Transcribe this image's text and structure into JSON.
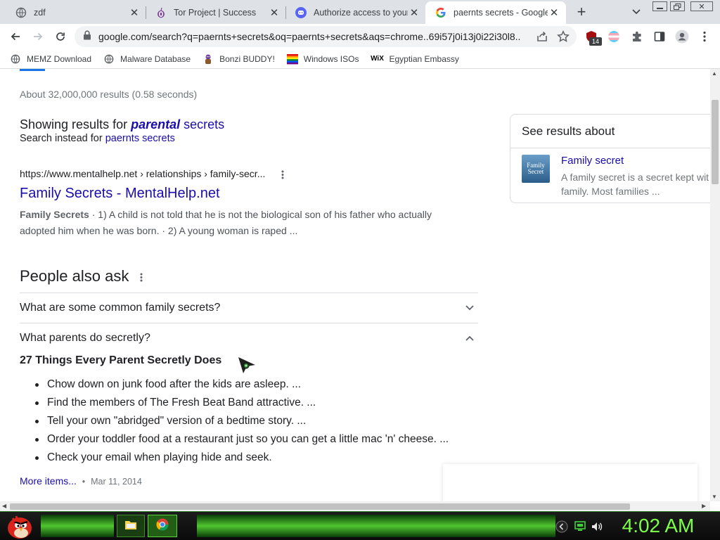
{
  "tabs": [
    {
      "title": "zdf",
      "icon": "globe-icon"
    },
    {
      "title": "Tor Project | Success",
      "icon": "tor-onion-icon"
    },
    {
      "title": "Authorize access to your",
      "icon": "discord-icon"
    },
    {
      "title": "paernts secrets - Google",
      "icon": "google-icon"
    }
  ],
  "new_tab_symbol": "+",
  "address_bar": {
    "url": "google.com/search?q=paernts+secrets&oq=paernts+secrets&aqs=chrome..69i57j0i13j0i22i30l8...."
  },
  "extension_badge": "14",
  "bookmarks": [
    {
      "label": "MEMZ Download",
      "icon": "globe-icon"
    },
    {
      "label": "Malware Database",
      "icon": "globe-icon"
    },
    {
      "label": "Bonzi BUDDY!",
      "icon": "bonzi-icon"
    },
    {
      "label": "Windows ISOs",
      "icon": "windows-flag-icon"
    },
    {
      "label": "Egyptian Embassy",
      "icon": "wix-icon"
    }
  ],
  "results": {
    "stats": "About 32,000,000 results (0.58 seconds)",
    "showing_prefix": "Showing results for ",
    "showing_bold": "parental",
    "showing_suffix": " secrets",
    "instead_prefix": "Search instead for ",
    "instead_link": "paernts secrets",
    "first": {
      "cite": "https://www.mentalhelp.net › relationships › family-secr...",
      "title": "Family Secrets - MentalHelp.net",
      "snippet_bold": "Family Secrets",
      "snippet_line1": " · 1) A child is not told that he is not the biological son of his father who actually",
      "snippet_line2": "adopted him when he was born. · 2) A young woman is raped ..."
    }
  },
  "paa": {
    "heading": "People also ask",
    "questions": [
      "What are some common family secrets?",
      "What parents do secretly?"
    ],
    "answer_title": "27 Things Every Parent Secretly Does",
    "items": [
      "Chow down on junk food after the kids are asleep. ...",
      "Find the members of The Fresh Beat Band attractive. ...",
      "Tell your own \"abridged\" version of a bedtime story. ...",
      "Order your toddler food at a restaurant just so you can get a little mac 'n' cheese. ...",
      "Check your email when playing hide and seek."
    ],
    "more_items": "More items...",
    "date": "Mar 11, 2014"
  },
  "side_panel": {
    "heading": "See results about",
    "entity_title": "Family secret",
    "entity_desc_line1": "A family secret is a secret kept wit",
    "entity_desc_line2": "family. Most families ...",
    "thumb_text": "Family Secret"
  },
  "taskbar": {
    "clock": "4:02 AM"
  },
  "colors": {
    "link": "#1a0dab",
    "clock": "#7dff4a",
    "taskbar_glow": "#4fc62f"
  }
}
